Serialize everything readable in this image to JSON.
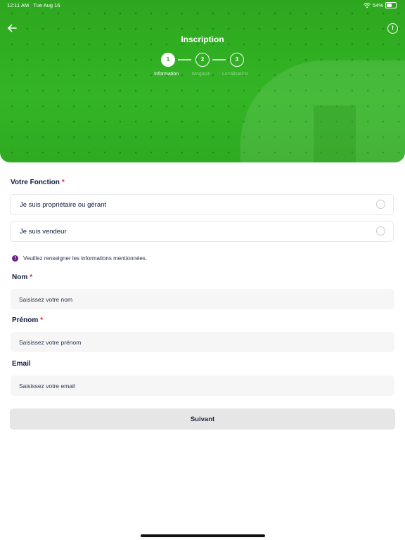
{
  "status_bar": {
    "time": "12:11 AM",
    "date": "Tue Aug 16",
    "battery": "54%"
  },
  "header": {
    "title": "Inscription",
    "back_icon": "arrow-left-icon",
    "info_icon": "info-circle-icon",
    "info_glyph": "!",
    "accent_color": "#2ea71f"
  },
  "stepper": {
    "current": 1,
    "steps": [
      {
        "number": "1",
        "label": "Information"
      },
      {
        "number": "2",
        "label": "Magasin"
      },
      {
        "number": "3",
        "label": "Localisation"
      }
    ]
  },
  "form": {
    "fonction_label": "Votre Fonction",
    "required_mark": "*",
    "options": [
      {
        "label": "Je suis propriétaire ou gérant",
        "selected": false
      },
      {
        "label": "Je suis vendeur",
        "selected": false
      }
    ],
    "notice": {
      "icon_glyph": "!",
      "text": "Veuillez renseigner les informations mentionnées."
    },
    "fields": {
      "nom": {
        "label": "Nom",
        "placeholder": "Saisissez votre nom",
        "value": ""
      },
      "prenom": {
        "label": "Prénom",
        "placeholder": "Saisissez votre prénom",
        "value": ""
      },
      "email": {
        "label": "Email",
        "placeholder": "Saisissez votre email",
        "value": ""
      }
    },
    "submit_label": "Suivant"
  }
}
